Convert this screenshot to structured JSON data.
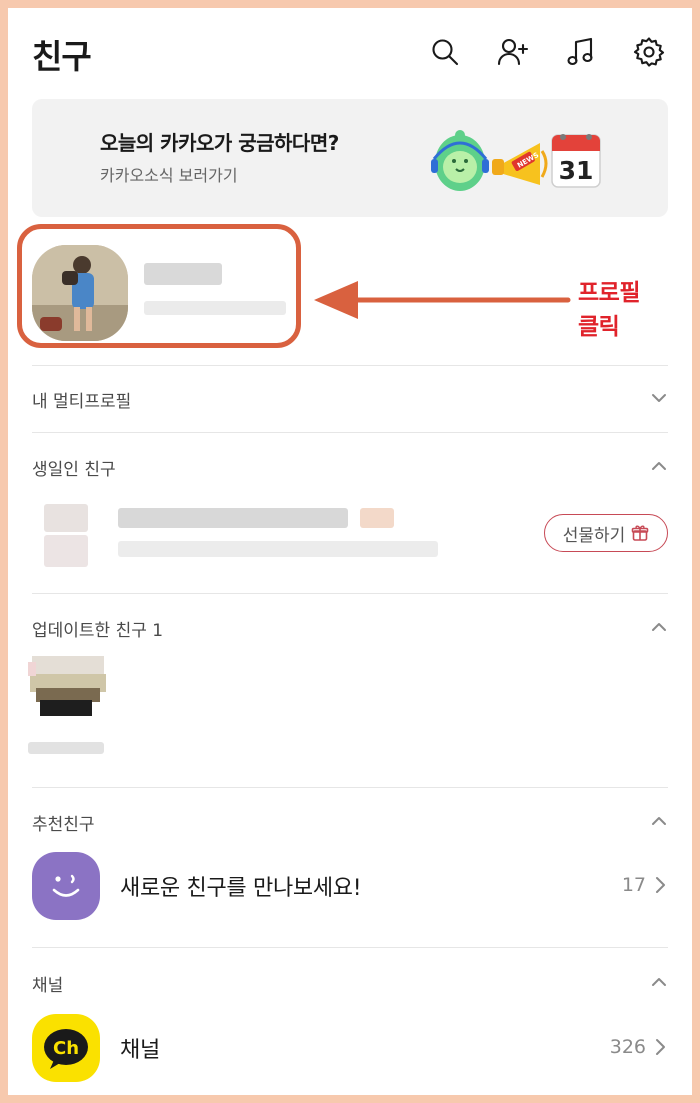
{
  "header": {
    "title": "친구",
    "icons": [
      "search-icon",
      "add-friend-icon",
      "music-icon",
      "settings-icon"
    ]
  },
  "banner": {
    "title": "오늘의 카카오가 궁금하다면?",
    "subtitle": "카카오소식 보러가기",
    "calendar_day": "31",
    "news_tag": "NEWS"
  },
  "annotation": {
    "text_line1": "프로필",
    "text_line2": "클릭",
    "color": "#e0232b",
    "box_color": "#d9613f"
  },
  "sections": {
    "multi_profile": "내 멀티프로필",
    "birthday": "생일인 친구",
    "updated": "업데이트한 친구 1",
    "recommended": "추천친구",
    "channel": "채널"
  },
  "birthday": {
    "gift_label": "선물하기"
  },
  "recommended": {
    "name": "새로운 친구를 만나보세요!",
    "count": "17"
  },
  "channel": {
    "name": "채널",
    "count": "326",
    "badge": "Ch"
  },
  "colors": {
    "accent_red": "#e0232b",
    "kakao_yellow": "#fae100",
    "purple": "#8b73c4"
  }
}
